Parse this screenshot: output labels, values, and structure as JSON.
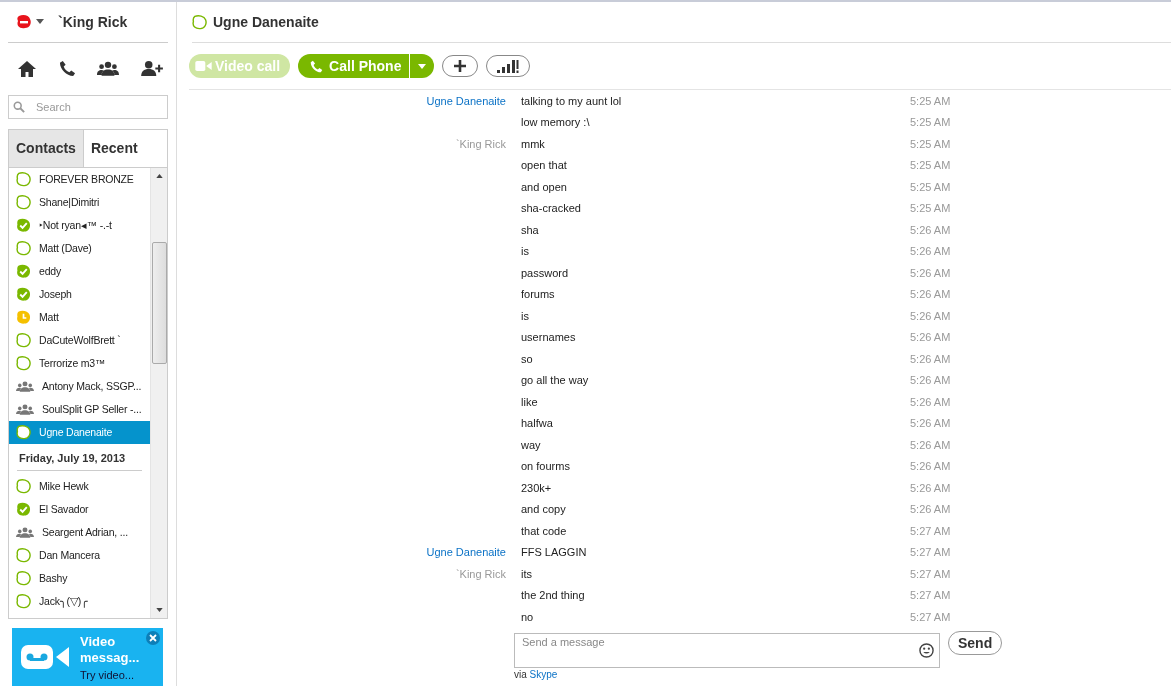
{
  "account": {
    "name": "`King Rick"
  },
  "search": {
    "placeholder": "Search"
  },
  "tabs": [
    {
      "label": "Contacts",
      "selected": true
    },
    {
      "label": "Recent",
      "selected": false
    }
  ],
  "contacts": [
    {
      "kind": "offline",
      "name": "FOREVER BRONZE",
      "selected": false
    },
    {
      "kind": "offline",
      "name": "Shane|Dimitri",
      "selected": false
    },
    {
      "kind": "online",
      "name": "‣Not ryan◂™ -.-t",
      "selected": false
    },
    {
      "kind": "offline",
      "name": "Matt (Dave)",
      "selected": false
    },
    {
      "kind": "online",
      "name": "eddy",
      "selected": false
    },
    {
      "kind": "online",
      "name": "Joseph",
      "selected": false
    },
    {
      "kind": "away",
      "name": "Matt",
      "selected": false
    },
    {
      "kind": "offline",
      "name": "DaCuteWolfBrett `",
      "selected": false
    },
    {
      "kind": "offline",
      "name": "Terrorize m3™",
      "selected": false
    },
    {
      "kind": "group",
      "name": "Antony Mack, SSGP...",
      "selected": false
    },
    {
      "kind": "group",
      "name": "SoulSplit GP Seller -...",
      "selected": false
    },
    {
      "kind": "offline",
      "name": "Ugne Danenaite",
      "selected": true
    },
    {
      "kind": "date",
      "name": "Friday, July 19, 2013"
    },
    {
      "kind": "offline",
      "name": "Mike Hewk",
      "selected": false
    },
    {
      "kind": "online",
      "name": "El Savador",
      "selected": false
    },
    {
      "kind": "group",
      "name": "Seargent Adrian, ...",
      "selected": false
    },
    {
      "kind": "offline",
      "name": "Dan Mancera",
      "selected": false
    },
    {
      "kind": "offline",
      "name": "Bashy",
      "selected": false
    },
    {
      "kind": "offline",
      "name": "Jack╮(▽)╭",
      "selected": false
    }
  ],
  "promo": {
    "title": "Video messag...",
    "subtitle": "Try video..."
  },
  "chat": {
    "name": "Ugne Danenaite"
  },
  "toolbar": {
    "video_call": {
      "label": "Video call",
      "disabled": true
    },
    "call_phone": {
      "label": "Call Phone"
    }
  },
  "messages": [
    {
      "sender": "Ugne Danenaite",
      "from_me": false,
      "text": "talking to my aunt lol",
      "time": "5:25 AM"
    },
    {
      "text": "low memory :\\",
      "time": "5:25 AM"
    },
    {
      "sender": "`King Rick",
      "from_me": true,
      "text": "mmk",
      "time": "5:25 AM"
    },
    {
      "text": "open that",
      "time": "5:25 AM"
    },
    {
      "text": "and open",
      "time": "5:25 AM"
    },
    {
      "text": "sha-cracked",
      "time": "5:25 AM"
    },
    {
      "text": "sha",
      "time": "5:26 AM"
    },
    {
      "text": "is",
      "time": "5:26 AM"
    },
    {
      "text": "password",
      "time": "5:26 AM"
    },
    {
      "text": "forums",
      "time": "5:26 AM"
    },
    {
      "text": "is",
      "time": "5:26 AM"
    },
    {
      "text": "usernames",
      "time": "5:26 AM"
    },
    {
      "text": "so",
      "time": "5:26 AM"
    },
    {
      "text": "go all the way",
      "time": "5:26 AM"
    },
    {
      "text": "like",
      "time": "5:26 AM"
    },
    {
      "text": "halfwa",
      "time": "5:26 AM"
    },
    {
      "text": "way",
      "time": "5:26 AM"
    },
    {
      "text": "on fourms",
      "time": "5:26 AM"
    },
    {
      "text": "230k+",
      "time": "5:26 AM"
    },
    {
      "text": "and copy",
      "time": "5:26 AM"
    },
    {
      "text": "that code",
      "time": "5:27 AM"
    },
    {
      "sender": "Ugne Danenaite",
      "from_me": false,
      "text": "FFS LAGGIN",
      "time": "5:27 AM"
    },
    {
      "sender": "`King Rick",
      "from_me": true,
      "text": "its",
      "time": "5:27 AM"
    },
    {
      "text": "the 2nd thing",
      "time": "5:27 AM"
    },
    {
      "text": "no",
      "time": "5:27 AM"
    }
  ],
  "composer": {
    "placeholder": "Send a message",
    "send": "Send",
    "via": "via",
    "service": "Skype"
  }
}
